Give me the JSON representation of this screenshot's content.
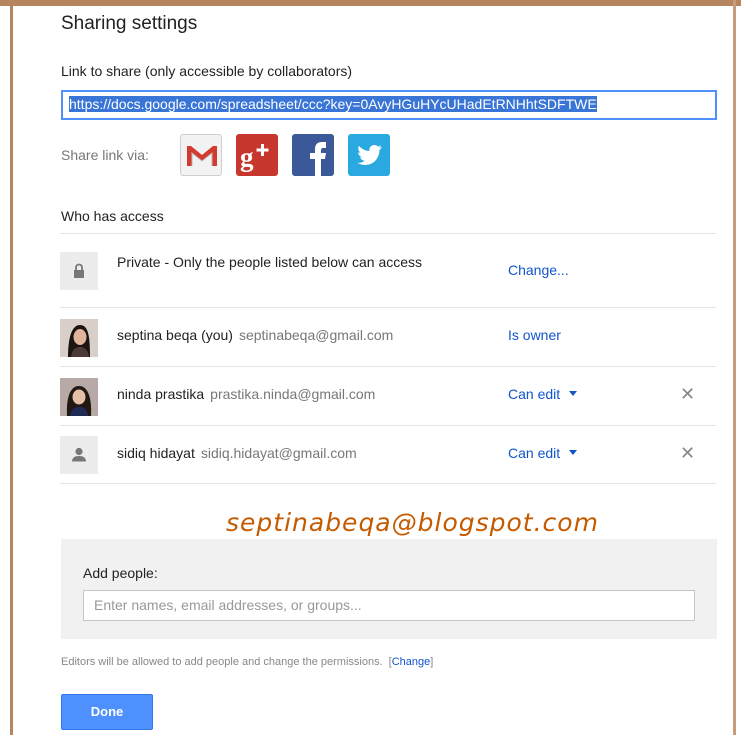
{
  "dialog": {
    "title": "Sharing settings",
    "link_label": "Link to share (only accessible by collaborators)",
    "link_value": "https://docs.google.com/spreadsheet/ccc?key=0AvyHGuHYcUHadEtRNHhtSDFTWE",
    "share_via_label": "Share link via:",
    "share_services": [
      "gmail-icon",
      "google-plus-icon",
      "facebook-icon",
      "twitter-icon"
    ],
    "who_has_access": "Who has access"
  },
  "access": {
    "private": {
      "text": "Private - Only the people listed below can access",
      "action": "Change..."
    },
    "people": [
      {
        "name": "septina beqa (you)",
        "email": "septinabeqa@gmail.com",
        "permission": "Is owner",
        "removable": false
      },
      {
        "name": "ninda prastika",
        "email": "prastika.ninda@gmail.com",
        "permission": "Can edit",
        "removable": true
      },
      {
        "name": "sidiq hidayat",
        "email": "sidiq.hidayat@gmail.com",
        "permission": "Can edit",
        "removable": true
      }
    ]
  },
  "watermark": "septinabeqa@blogspot.com",
  "add_people": {
    "label": "Add people:",
    "placeholder": "Enter names, email addresses, or groups..."
  },
  "footer": {
    "note": "Editors will be allowed to add people and change the permissions.",
    "bracket_open": "[",
    "change_link": "Change",
    "bracket_close": "]",
    "done_label": "Done"
  },
  "colors": {
    "link_blue": "#1155cc",
    "primary_button": "#4d90fe",
    "frame": "#b5855f",
    "watermark": "#c65a00"
  }
}
